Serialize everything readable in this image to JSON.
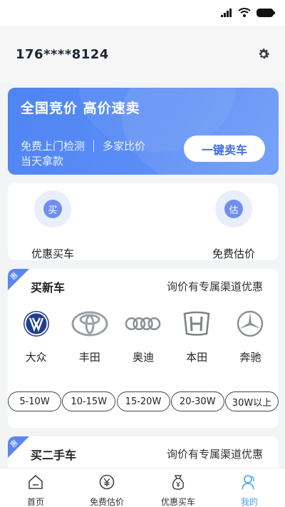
{
  "user": {
    "phone": "176****8124"
  },
  "banner": {
    "title": "全国竞价  高价速卖",
    "sub_a": "免费上门检测",
    "sub_b": "多家比价",
    "sub_c": "当天拿款",
    "button": "一键卖车"
  },
  "quick": [
    {
      "icon_char": "买",
      "label": "优惠买车",
      "icon": "buy-car-icon"
    },
    {
      "icon_char": "估",
      "label": "免费估价",
      "icon": "valuation-icon"
    }
  ],
  "new_car": {
    "badge": "惠",
    "title": "买新车",
    "note": "询价有专属渠道优惠",
    "brands": [
      {
        "name": "大众",
        "icon": "volkswagen-logo-icon"
      },
      {
        "name": "丰田",
        "icon": "toyota-logo-icon"
      },
      {
        "name": "奥迪",
        "icon": "audi-logo-icon"
      },
      {
        "name": "本田",
        "icon": "honda-logo-icon"
      },
      {
        "name": "奔驰",
        "icon": "mercedes-logo-icon"
      }
    ],
    "price_ranges": [
      "5-10W",
      "10-15W",
      "15-20W",
      "20-30W",
      "30W以上"
    ]
  },
  "used_car": {
    "badge": "惠",
    "title": "买二手车",
    "note": "询价有专属渠道优惠"
  },
  "tabbar": [
    {
      "label": "首页",
      "icon": "home-icon",
      "active": false
    },
    {
      "label": "免费估价",
      "icon": "yen-icon",
      "active": false
    },
    {
      "label": "优惠买车",
      "icon": "money-bag-icon",
      "active": false
    },
    {
      "label": "我的",
      "icon": "user-icon",
      "active": true
    }
  ],
  "colors": {
    "accent": "#5a8df6",
    "tab_active": "#4aa3e8"
  }
}
